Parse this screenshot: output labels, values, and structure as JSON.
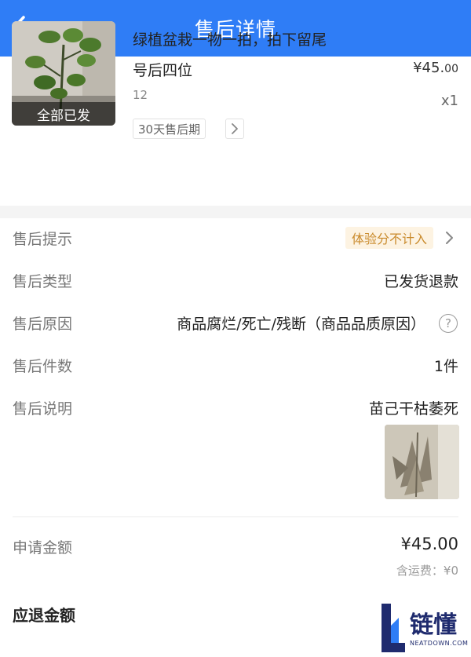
{
  "header": {
    "title": "售后详情",
    "back_icon": "chevron-left-icon"
  },
  "product": {
    "title_line1": "绿植盆栽一物一拍，拍下留尾",
    "title_line2": "号后四位",
    "price_main": "¥45.",
    "price_dec": "00",
    "spec": "12",
    "quantity": "x1",
    "thumbnail_badge": "全部已发",
    "policy_tag": "30天售后期"
  },
  "details": {
    "tip_label": "售后提示",
    "tip_value": "体验分不计入",
    "type_label": "售后类型",
    "type_value": "已发货退款",
    "reason_label": "售后原因",
    "reason_value": "商品腐烂/死亡/残断（商品品质原因）",
    "count_label": "售后件数",
    "count_value": "1件",
    "desc_label": "售后说明",
    "desc_value": "苗己干枯萎死"
  },
  "amount": {
    "apply_label": "申请金额",
    "apply_value": "¥45.00",
    "shipping_note": "含运费：¥0",
    "refund_label": "应退金额"
  },
  "watermark": {
    "text": "链懂",
    "sub": "NEATDOWN.COM"
  },
  "colors": {
    "header_bg": "#2f7df6",
    "hint_bg": "#fdf3e2",
    "hint_text": "#c98a2b"
  }
}
